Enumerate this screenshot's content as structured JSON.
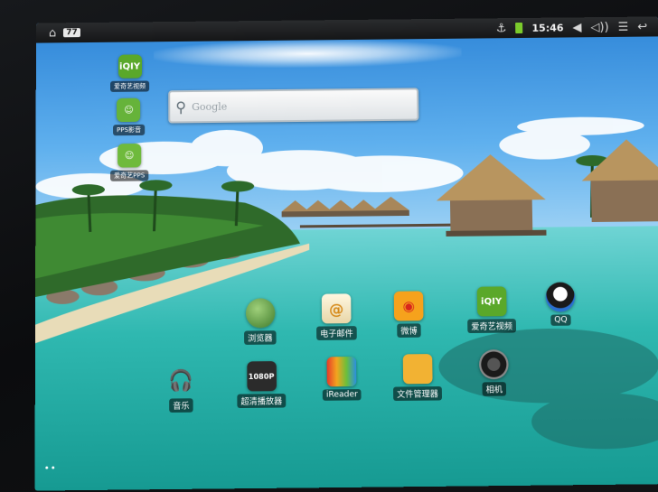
{
  "statusbar": {
    "home_icon": "home-icon",
    "notification_badge": "77",
    "time": "15:46",
    "icons": [
      "usb-icon",
      "battery-icon",
      "volume-down-icon",
      "volume-up-icon",
      "menu-icon",
      "back-icon"
    ]
  },
  "search": {
    "placeholder": "Google"
  },
  "apps": {
    "left": [
      {
        "label": "爱奇艺视频",
        "icon": "iqiyi-icon"
      },
      {
        "label": "PPS影音",
        "icon": "pps-icon"
      },
      {
        "label": "爱奇艺PPS",
        "icon": "iqiyi-pps-icon"
      }
    ],
    "row1": [
      {
        "label": "浏览器",
        "icon": "browser-globe-icon"
      },
      {
        "label": "电子邮件",
        "icon": "email-icon"
      },
      {
        "label": "微博",
        "icon": "weibo-icon"
      },
      {
        "label": "爱奇艺视频",
        "icon": "iqiyi-icon"
      },
      {
        "label": "QQ",
        "icon": "qq-penguin-icon"
      }
    ],
    "row2": [
      {
        "label": "音乐",
        "icon": "headphones-icon"
      },
      {
        "label": "超清播放器",
        "icon": "1080p-player-icon"
      },
      {
        "label": "iReader",
        "icon": "ireader-icon"
      },
      {
        "label": "文件管理器",
        "icon": "folder-icon"
      },
      {
        "label": "相机",
        "icon": "camera-icon"
      }
    ]
  },
  "page_indicator": "••"
}
